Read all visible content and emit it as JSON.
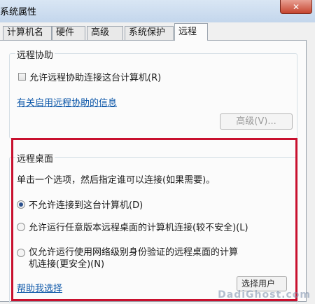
{
  "window": {
    "title": "系统属性",
    "close_glyph": "✕"
  },
  "tabs": [
    {
      "label": "计算机名"
    },
    {
      "label": "硬件"
    },
    {
      "label": "高级"
    },
    {
      "label": "系统保护"
    },
    {
      "label": "远程"
    }
  ],
  "remote_assistance": {
    "group_title": "远程协助",
    "allow_label": "允许远程协助连接这台计算机(R)",
    "allow_checked": false,
    "info_link": "有关启用远程协助的信息",
    "advanced_button": "高级(V)..."
  },
  "remote_desktop": {
    "group_title": "远程桌面",
    "instruction": "单击一个选项，然后指定谁可以连接(如果需要)。",
    "options": [
      {
        "label": "不允许连接到这台计算机(D)",
        "checked": true
      },
      {
        "label": "允许运行任意版本远程桌面的计算机连接(较不安全)(L)",
        "checked": false
      },
      {
        "label_line1": "仅允许运行使用网络级别身份验证的远程桌面的计算",
        "label_line2": "机连接(更安全)(N)",
        "checked": false
      }
    ],
    "help_link": "帮助我选择",
    "select_users_button": "选择用户(S)..."
  },
  "watermark": "DadiGhost.com",
  "colors": {
    "highlight_border": "#c8102e",
    "link": "#0b56a8",
    "titlebar": "#c3d6ec"
  }
}
